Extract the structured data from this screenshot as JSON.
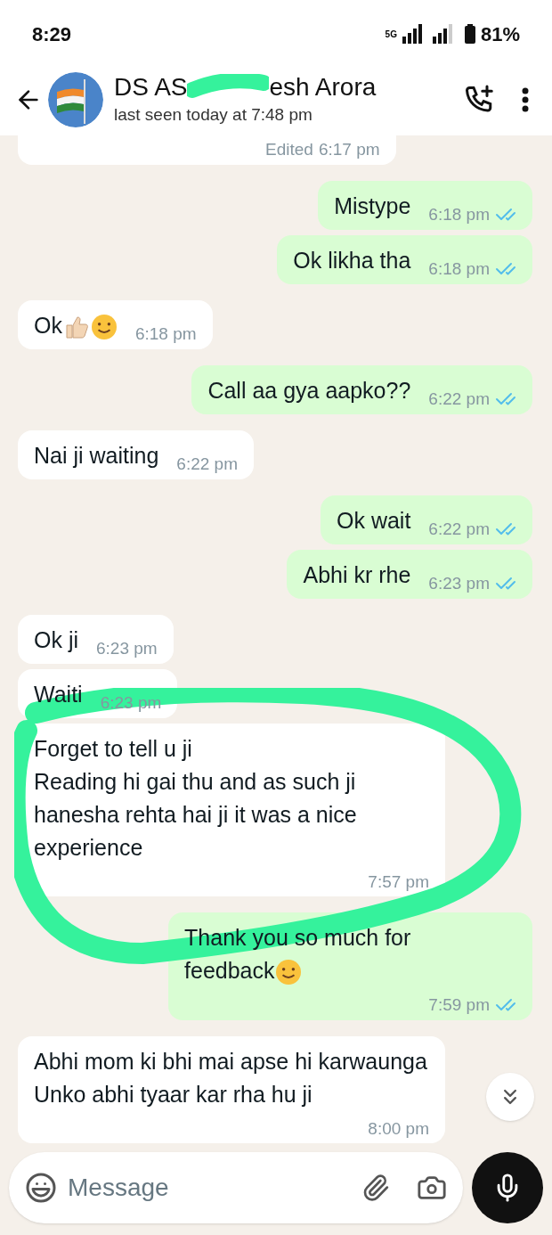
{
  "status_bar": {
    "time": "8:29",
    "network": "5G",
    "battery": "81%"
  },
  "header": {
    "name_parts": [
      "DS AS",
      "esh Arora"
    ],
    "status": "last seen today at 7:48 pm"
  },
  "messages": [
    {
      "kind": "in",
      "time": "6:17 pm",
      "edited": "Edited"
    },
    {
      "kind": "out",
      "text": "Mistype",
      "time": "6:18 pm",
      "read": true
    },
    {
      "kind": "out",
      "text": "Ok likha tha",
      "time": "6:18 pm",
      "read": true
    },
    {
      "kind": "in",
      "text": "Ok",
      "emojis": [
        {
          "kind": "thumbs_up"
        },
        {
          "kind": "smile"
        }
      ],
      "time": "6:18 pm"
    },
    {
      "kind": "out",
      "text": "Call aa gya aapko??",
      "time": "6:22 pm",
      "read": true
    },
    {
      "kind": "in",
      "text": "Nai ji waiting",
      "time": "6:22 pm"
    },
    {
      "kind": "out",
      "text": "Ok wait",
      "time": "6:22 pm",
      "read": true
    },
    {
      "kind": "out",
      "text": "Abhi kr rhe",
      "time": "6:23 pm",
      "read": true
    },
    {
      "kind": "in",
      "text": "Ok ji",
      "time": "6:23 pm"
    },
    {
      "kind": "in",
      "text": "Waiti",
      "time": "6:23 pm"
    },
    {
      "kind": "in",
      "text": "Forget to tell u ji\nReading hi gai thu and as such ji hanesha rehta hai ji it was a nice experience",
      "time": "7:57 pm"
    },
    {
      "kind": "out",
      "text": "Thank you so much for\nfeedback",
      "emojis": [
        {
          "kind": "smile"
        }
      ],
      "time": "7:59 pm",
      "read": true
    },
    {
      "kind": "in",
      "text": "Abhi mom ki bhi mai apse hi karwaunga\nUnko abhi tyaar kar rha hu ji",
      "time": "8:00 pm"
    }
  ],
  "composer": {
    "placeholder": "Message"
  }
}
